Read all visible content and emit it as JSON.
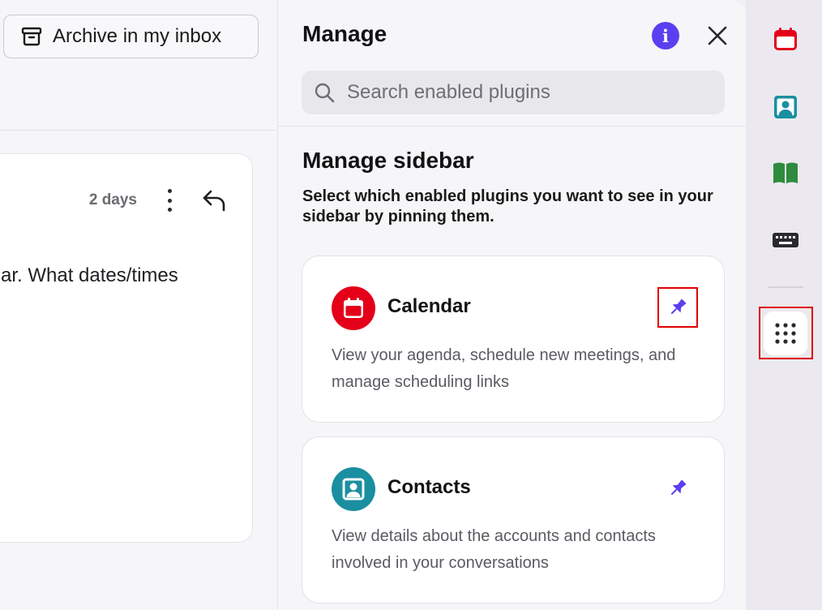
{
  "email": {
    "archive_label": "Archive in my inbox",
    "time": "2 days",
    "body_snippet": "ar. What dates/times"
  },
  "manage": {
    "title": "Manage",
    "search_placeholder": "Search enabled plugins",
    "section_title": "Manage sidebar",
    "section_desc": "Select which enabled plugins you want to see in your sidebar by pinning them.",
    "plugins": [
      {
        "name": "Calendar",
        "desc": "View your agenda, schedule new meetings, and manage scheduling links",
        "icon": "calendar-icon",
        "pinned": true,
        "color": "#e5001a"
      },
      {
        "name": "Contacts",
        "desc": "View details about the accounts and contacts involved in your conversations",
        "icon": "contact-icon",
        "pinned": true,
        "color": "#1a8fa0"
      }
    ]
  },
  "rail": {
    "items": [
      "calendar-icon",
      "contact-icon",
      "book-icon",
      "keyboard-icon",
      "apps-grid-icon"
    ]
  },
  "colors": {
    "accent": "#5a3ff0",
    "highlight": "#e00000",
    "calendar": "#e5001a",
    "contacts": "#1a8fa0",
    "book": "#2e8b3d",
    "keyboard": "#2a2a2e"
  }
}
